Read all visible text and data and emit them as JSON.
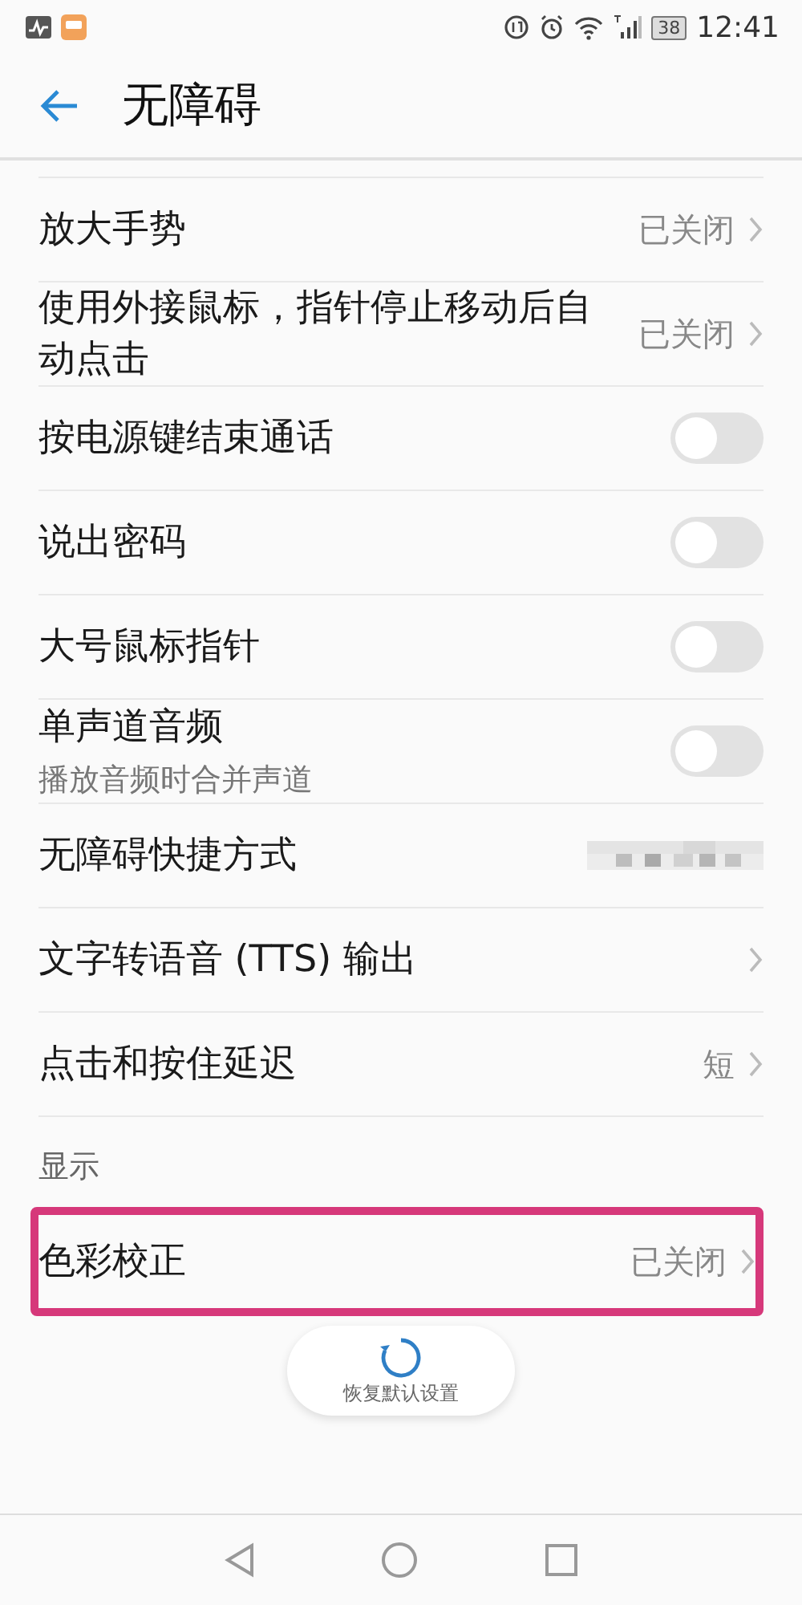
{
  "status_bar": {
    "time": "12:41",
    "battery": "38"
  },
  "header": {
    "title": "无障碍"
  },
  "items": [
    {
      "kind": "value",
      "title": "放大手势",
      "value": "已关闭",
      "highlighted": false
    },
    {
      "kind": "value",
      "title": "使用外接鼠标，指针停止移动后自动点击",
      "value": "已关闭",
      "highlighted": false
    },
    {
      "kind": "toggle",
      "title": "按电源键结束通话",
      "on": false,
      "highlighted": false
    },
    {
      "kind": "toggle",
      "title": "说出密码",
      "on": false,
      "highlighted": false
    },
    {
      "kind": "toggle",
      "title": "大号鼠标指针",
      "on": false,
      "highlighted": false
    },
    {
      "kind": "toggle",
      "title": "单声道音频",
      "subtitle": "播放音频时合并声道",
      "on": false,
      "highlighted": false
    },
    {
      "kind": "obscured",
      "title": "无障碍快捷方式",
      "highlighted": false
    },
    {
      "kind": "link",
      "title": "文字转语音 (TTS) 输出",
      "highlighted": false
    },
    {
      "kind": "value",
      "title": "点击和按住延迟",
      "value": "短",
      "highlighted": false
    },
    {
      "kind": "section",
      "title": "显示"
    },
    {
      "kind": "value",
      "title": "色彩校正",
      "value": "已关闭",
      "highlighted": true
    }
  ],
  "restore_button": {
    "label": "恢复默认设置"
  }
}
